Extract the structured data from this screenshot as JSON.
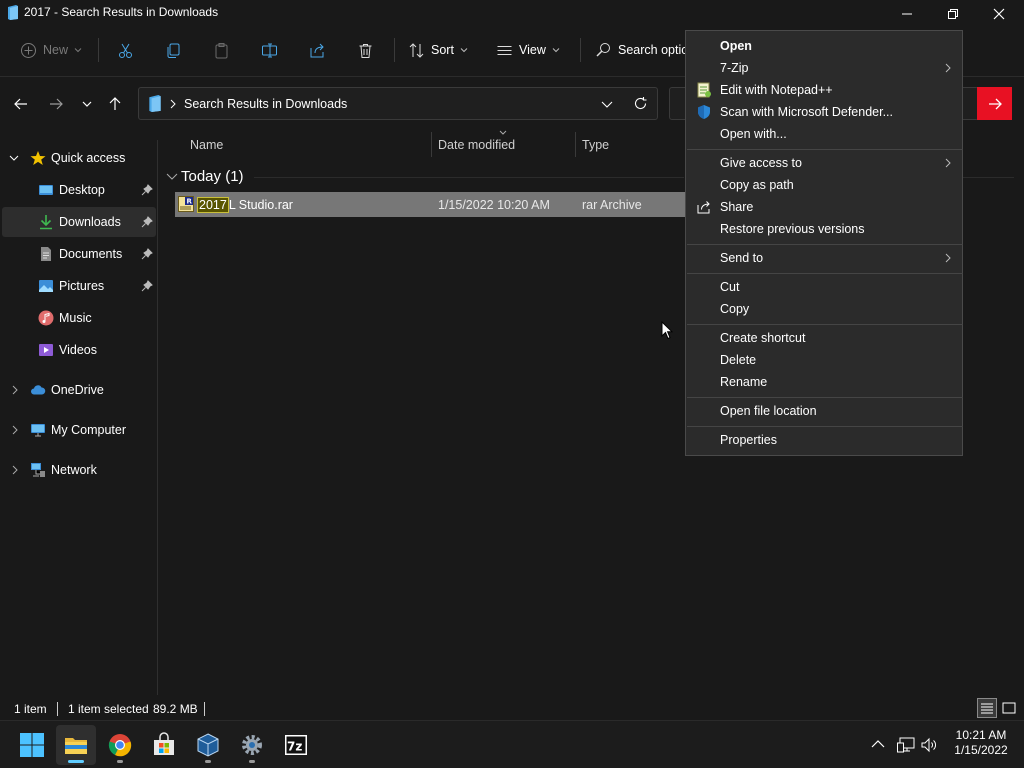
{
  "window": {
    "title": "2017 - Search Results in Downloads"
  },
  "commandbar": {
    "new_label": "New",
    "sort_label": "Sort",
    "view_label": "View",
    "search_options_label": "Search optic"
  },
  "address": {
    "path": "Search Results in Downloads"
  },
  "sidebar": {
    "quick_access": "Quick access",
    "items": [
      {
        "label": "Desktop",
        "icon": "desktop-icon",
        "pinned": true
      },
      {
        "label": "Downloads",
        "icon": "download-icon",
        "pinned": true,
        "selected": true
      },
      {
        "label": "Documents",
        "icon": "documents-icon",
        "pinned": true
      },
      {
        "label": "Pictures",
        "icon": "pictures-icon",
        "pinned": true
      },
      {
        "label": "Music",
        "icon": "music-icon",
        "pinned": false
      },
      {
        "label": "Videos",
        "icon": "videos-icon",
        "pinned": false
      }
    ],
    "onedrive": "OneDrive",
    "my_computer": "My Computer",
    "network": "Network"
  },
  "columns": {
    "name": "Name",
    "date_modified": "Date modified",
    "type": "Type"
  },
  "group": {
    "label": "Today (1)"
  },
  "file": {
    "name_highlight": "2017",
    "name_rest": "L Studio.rar",
    "date": "1/15/2022 10:20 AM",
    "type": "rar Archive"
  },
  "context_menu": {
    "open": "Open",
    "seven_zip": "7-Zip",
    "edit_notepad": "Edit with Notepad++",
    "scan_defender": "Scan with Microsoft Defender...",
    "open_with": "Open with...",
    "give_access": "Give access to",
    "copy_as_path": "Copy as path",
    "share": "Share",
    "restore_versions": "Restore previous versions",
    "send_to": "Send to",
    "cut": "Cut",
    "copy": "Copy",
    "create_shortcut": "Create shortcut",
    "delete": "Delete",
    "rename": "Rename",
    "open_file_location": "Open file location",
    "properties": "Properties"
  },
  "statusbar": {
    "item_count": "1 item",
    "selected": "1 item selected",
    "size": "89.2 MB"
  },
  "taskbar": {
    "time": "10:21 AM",
    "date": "1/15/2022"
  },
  "colors": {
    "accent": "#60cdff",
    "search_button": "#e81123",
    "selection": "#777777",
    "highlight": "#c9bf3a"
  }
}
